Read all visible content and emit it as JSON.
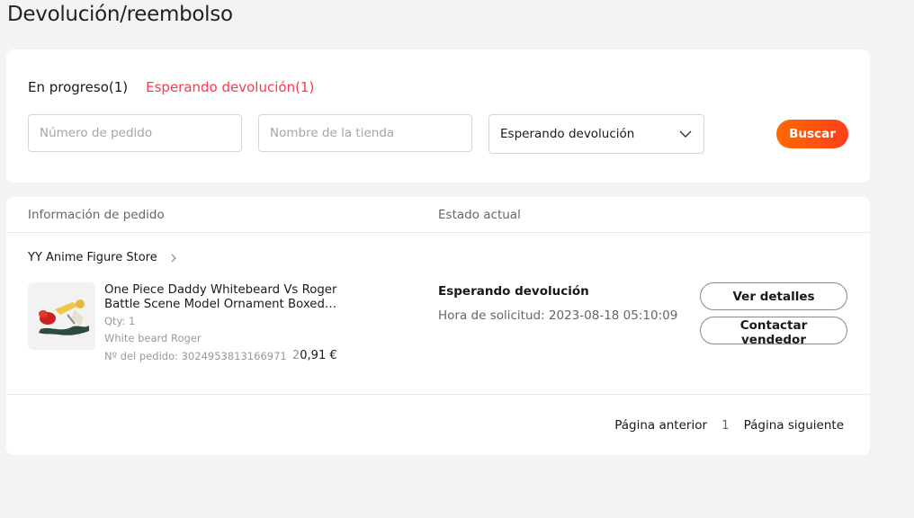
{
  "page": {
    "title": "Devolución/reembolso"
  },
  "tabs": [
    {
      "label": "En progreso(1)"
    },
    {
      "label": "Esperando devolución(1)"
    }
  ],
  "filters": {
    "order_number_placeholder": "Número de pedido",
    "store_name_placeholder": "Nombre de la tienda",
    "status_selected": "Esperando devolución",
    "search_label": "Buscar"
  },
  "table": {
    "headers": {
      "order_info": "Información de pedido",
      "current_status": "Estado actual"
    }
  },
  "order": {
    "store_name": "YY Anime Figure Store",
    "product_title": "One Piece Daddy Whitebeard Vs Roger Battle Scene Model Ornament Boxed Figure",
    "qty": "Qty: 1",
    "variant": "White beard Roger",
    "order_number": "Nº del pedido: 3024953813166971",
    "price_prefix": "2",
    "price": "0,91 €",
    "status": "Esperando devolución",
    "request_time": "Hora de solicitud: 2023-08-18 05:10:09",
    "details_label": "Ver detalles",
    "contact_label": "Contactar vendedor"
  },
  "pagination": {
    "prev": "Página anterior",
    "current": "1",
    "next": "Página siguiente"
  },
  "colors": {
    "accent": "#fd384f",
    "button_gradient_start": "#ff6a00",
    "button_gradient_end": "#fd3f1c"
  }
}
